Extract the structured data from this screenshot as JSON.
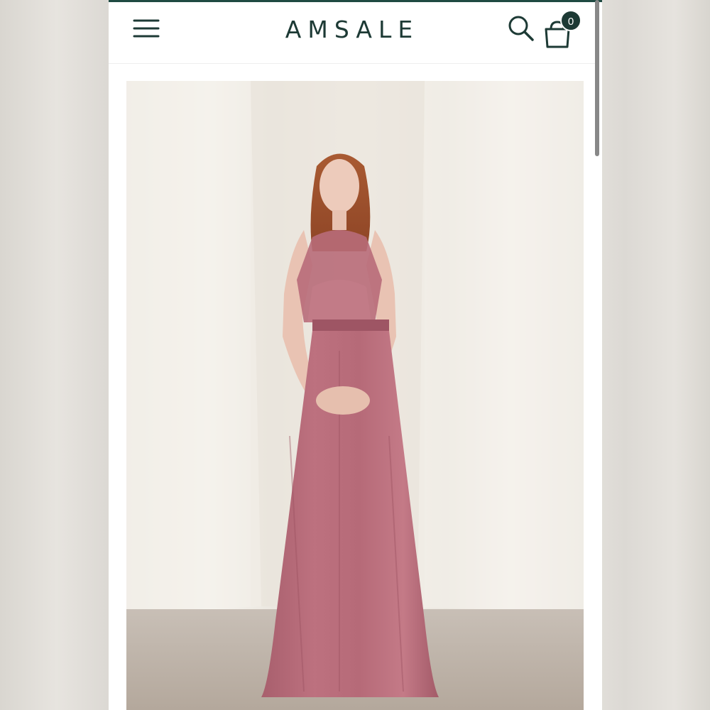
{
  "header": {
    "logo": "AMSALE",
    "cart_count": "0"
  },
  "icons": {
    "menu": "hamburger-menu-icon",
    "search": "search-icon",
    "cart": "shopping-bag-icon"
  },
  "colors": {
    "brand": "#1d3a35",
    "dress": "#b56a78",
    "background": "#ffffff"
  }
}
